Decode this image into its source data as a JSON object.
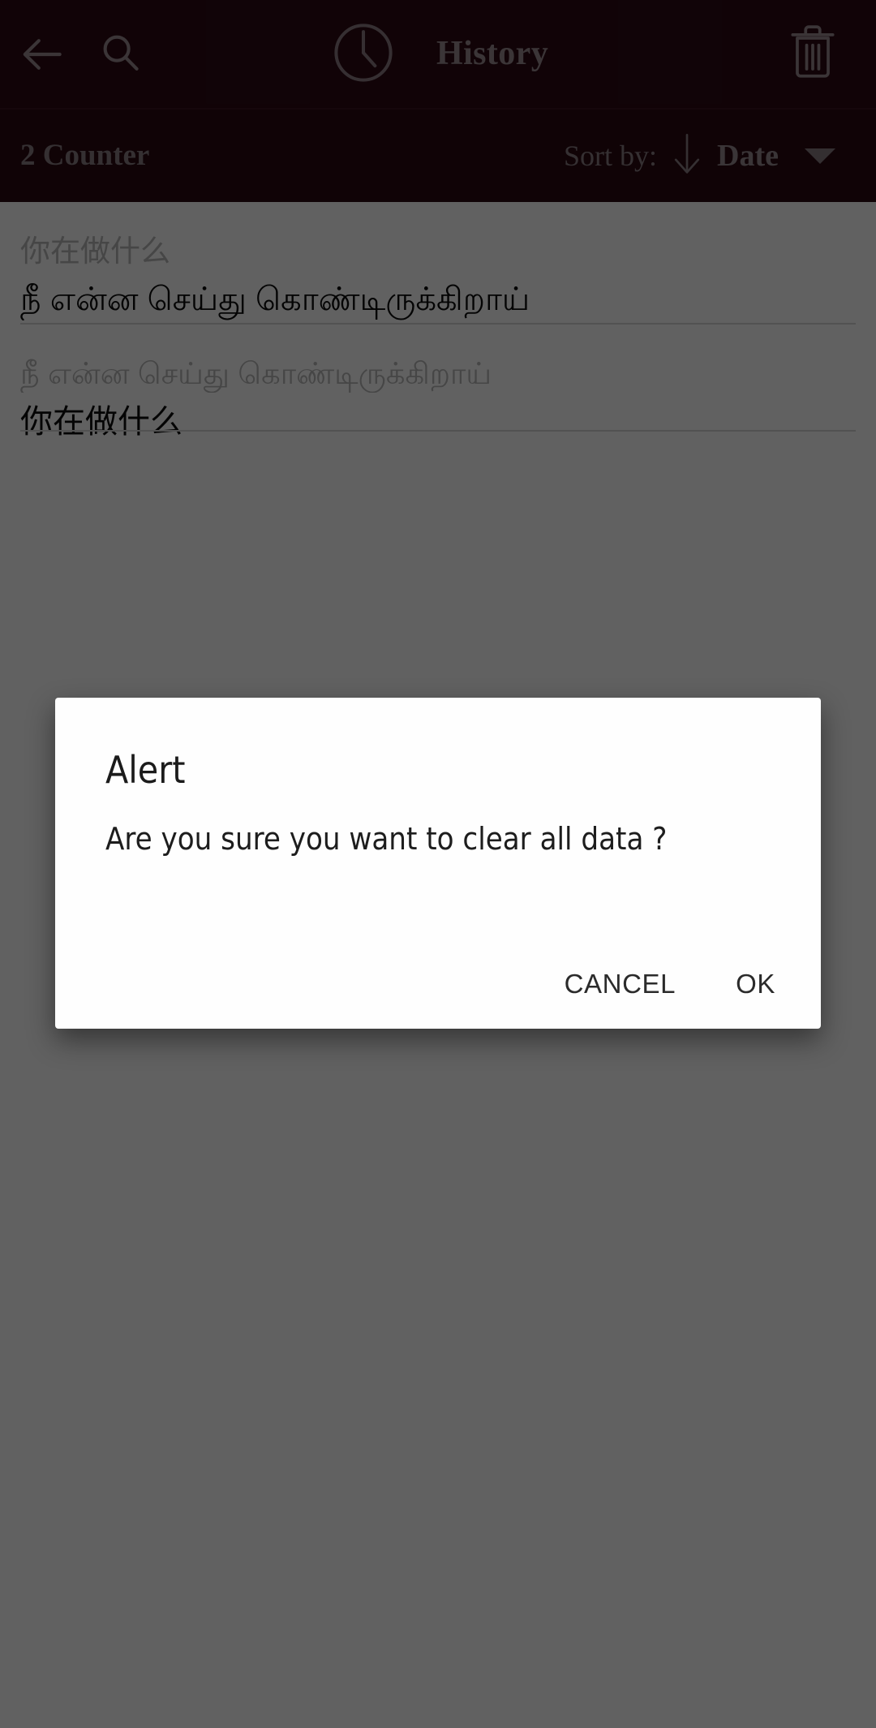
{
  "appbar": {
    "title": "History",
    "back_icon": "arrow-left-icon",
    "search_icon": "search-icon",
    "clock_icon": "clock-icon",
    "delete_icon": "trash-icon",
    "background_color": "#2e0a14",
    "foreground_color": "#9b8b90"
  },
  "sortbar": {
    "counter_label": "2 Counter",
    "sort_by_label": "Sort by:",
    "sort_direction_icon": "arrow-down-icon",
    "sort_field": "Date",
    "dropdown_icon": "chevron-down-icon",
    "background_color": "#2a0812"
  },
  "history": {
    "items": [
      {
        "source_text": "你在做什么",
        "translated_text": "நீ என்ன செய்து கொண்டிருக்கிறாய்"
      },
      {
        "source_text": "நீ என்ன செய்து கொண்டிருக்கிறாய்",
        "translated_text": "你在做什么"
      }
    ]
  },
  "dialog": {
    "title": "Alert",
    "message": "Are you sure you want to clear all data ?",
    "cancel_label": "CANCEL",
    "ok_label": "OK",
    "background_color": "#fefefe",
    "text_color": "#1b1b1b"
  },
  "scrim": {
    "color": "rgba(0,0,0,0.62)"
  }
}
